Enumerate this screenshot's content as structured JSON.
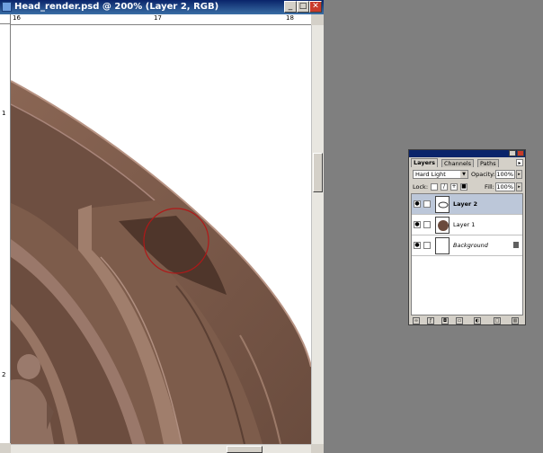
{
  "document": {
    "title": "Head_render.psd @ 200% (Layer 2, RGB)",
    "title_buttons": {
      "minimize": "_",
      "maximize": "□",
      "close": "✕"
    },
    "ruler_h_labels": [
      "16",
      "17",
      "18"
    ],
    "ruler_v_labels": [
      "1",
      "2"
    ]
  },
  "layers_panel": {
    "tabs": [
      "Layers",
      "Channels",
      "Paths"
    ],
    "active_tab": "Layers",
    "blend_mode": "Hard Light",
    "opacity_label": "Opacity:",
    "opacity_value": "100%",
    "lock_label": "Lock:",
    "fill_label": "Fill:",
    "fill_value": "100%",
    "layers": [
      {
        "name": "Layer 2",
        "selected": true,
        "locked": false
      },
      {
        "name": "Layer 1",
        "selected": false,
        "locked": false
      },
      {
        "name": "Background",
        "selected": false,
        "locked": true
      }
    ],
    "footer_icons": [
      "link-layers-icon",
      "layer-style-icon",
      "mask-icon",
      "new-group-icon",
      "adjustment-layer-icon",
      "new-layer-icon",
      "trash-icon"
    ]
  },
  "colors": {
    "clay": "#7a5a4a",
    "clay_light": "#9a7866",
    "clay_dark": "#5a3f33",
    "annotation_circle": "#b01818"
  }
}
